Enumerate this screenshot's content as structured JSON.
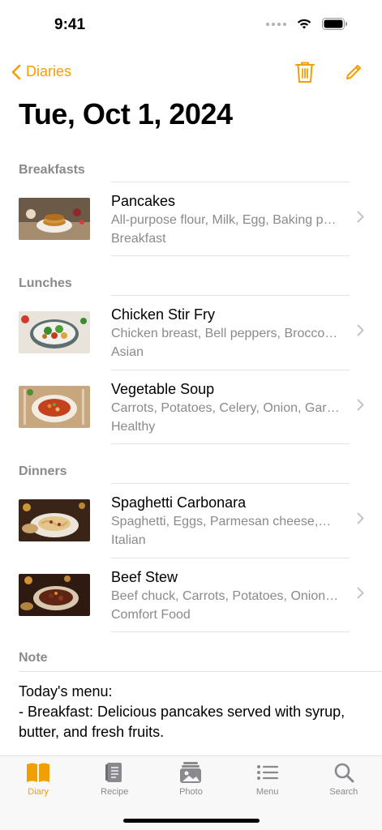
{
  "status": {
    "time": "9:41"
  },
  "nav": {
    "back_label": "Diaries"
  },
  "page": {
    "title": "Tue, Oct 1, 2024"
  },
  "colors": {
    "accent": "#F29F05",
    "secondary_text": "#8a8a8e",
    "separator": "#e3e3e6"
  },
  "sections": [
    {
      "header": "Breakfasts",
      "items": [
        {
          "title": "Pancakes",
          "ingredients": "All-purpose flour, Milk, Egg, Baking p…",
          "category": "Breakfast"
        }
      ]
    },
    {
      "header": "Lunches",
      "items": [
        {
          "title": "Chicken Stir Fry",
          "ingredients": "Chicken breast, Bell peppers, Brocco…",
          "category": "Asian"
        },
        {
          "title": "Vegetable Soup",
          "ingredients": "Carrots, Potatoes, Celery, Onion, Gar…",
          "category": "Healthy"
        }
      ]
    },
    {
      "header": "Dinners",
      "items": [
        {
          "title": "Spaghetti Carbonara",
          "ingredients": "Spaghetti, Eggs, Parmesan cheese,…",
          "category": "Italian"
        },
        {
          "title": "Beef Stew",
          "ingredients": "Beef chuck, Carrots, Potatoes, Onion…",
          "category": "Comfort Food"
        }
      ]
    }
  ],
  "note": {
    "header": "Note",
    "text": "Today's menu:\n- Breakfast: Delicious pancakes served with syrup, butter, and fresh fruits."
  },
  "tabs": [
    {
      "label": "Diary",
      "icon": "book-icon",
      "active": true
    },
    {
      "label": "Recipe",
      "icon": "recipe-book-icon",
      "active": false
    },
    {
      "label": "Photo",
      "icon": "photo-icon",
      "active": false
    },
    {
      "label": "Menu",
      "icon": "list-icon",
      "active": false
    },
    {
      "label": "Search",
      "icon": "search-icon",
      "active": false
    }
  ]
}
